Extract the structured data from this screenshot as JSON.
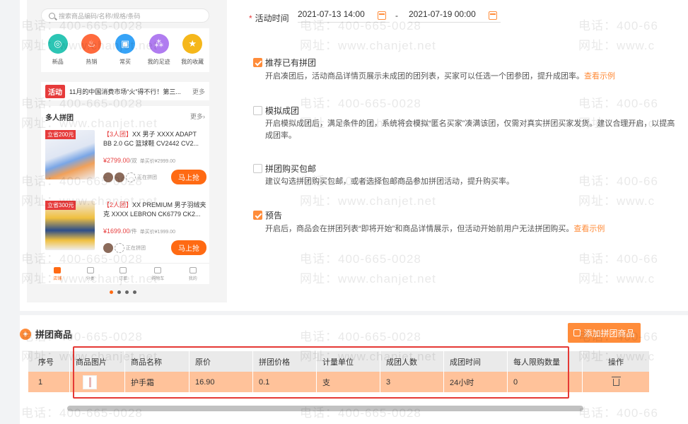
{
  "preview": {
    "search_placeholder": "搜索商品编码/名称/规格/条码",
    "nav": [
      {
        "label": "新品",
        "color": "#2cc5b4",
        "icon": "new-icon"
      },
      {
        "label": "热销",
        "color": "#ff6a3d",
        "icon": "fire-icon"
      },
      {
        "label": "常买",
        "color": "#36a3f7",
        "icon": "bag-icon"
      },
      {
        "label": "我的足迹",
        "color": "#b07cf0",
        "icon": "footprint-icon"
      },
      {
        "label": "我的收藏",
        "color": "#f5b71b",
        "icon": "star-icon"
      }
    ],
    "activity_tag": "活动",
    "activity_text": "11月的中国消费市场“火”得不行！第三...",
    "activity_more": "更多",
    "group_title": "多人拼团",
    "group_more": "更多›",
    "products": [
      {
        "save": "立省200元",
        "team": "【3人团】",
        "name": "XX 男子 XXXX ADAPT BB 2.0 GC 篮球鞋 CV2442 CV2...",
        "price": "¥2799.00",
        "unit": "/双",
        "orig": "单买价¥2999.00",
        "status": "正在拼团",
        "buy": "马上抢"
      },
      {
        "save": "立省300元",
        "team": "【2人团】",
        "name": "XX PREMIUM 男子羽绒夹克 XXXX LEBRON CK6779 CK2...",
        "price": "¥1699.00",
        "unit": "/件",
        "orig": "单买价¥1999.00",
        "status": "正在拼团",
        "buy": "马上抢"
      }
    ],
    "tabs": [
      "店铺",
      "分类",
      "订单",
      "购物车",
      "我的"
    ]
  },
  "settings": {
    "time_label": "活动时间",
    "start": "2021-07-13 14:00",
    "sep": "-",
    "end": "2021-07-19 00:00",
    "options": [
      {
        "title": "推荐已有拼团",
        "checked": true,
        "desc": "开启凑团后，活动商品详情页展示未成团的团列表，买家可以任选一个团参团，提升成团率。",
        "link": "查看示例"
      },
      {
        "title": "模拟成团",
        "checked": false,
        "desc": "开启模拟成团后，满足条件的团，系统将会模拟“匿名买家”凑满该团，仅需对真实拼团买家发货。建议合理开启，以提高成团率。",
        "link": ""
      },
      {
        "title": "拼团购买包邮",
        "checked": false,
        "desc": "建议勾选拼团购买包邮，或者选择包邮商品参加拼团活动，提升购买率。",
        "link": ""
      },
      {
        "title": "预告",
        "checked": true,
        "desc": "开启后，商品会在拼团列表“即将开始”和商品详情展示，但活动开始前用户无法拼团购买。",
        "link": "查看示例"
      }
    ]
  },
  "section": {
    "title": "拼团商品",
    "add_button": "添加拼团商品"
  },
  "table": {
    "headers": [
      "序号",
      "商品图片",
      "商品名称",
      "原价",
      "拼团价格",
      "计量单位",
      "成团人数",
      "成团时间",
      "每人限购数量",
      "操作"
    ],
    "rows": [
      {
        "index": "1",
        "name": "护手霜",
        "price": "16.90",
        "group_price": "0.1",
        "unit": "支",
        "people": "3",
        "time": "24小时",
        "limit": "0"
      }
    ]
  },
  "watermark": {
    "phone": "电话：400-665-0028",
    "site": "网址：www.chanjet.net",
    "phone_cut": "电话：400-66",
    "site_cut": "网址：www.c"
  },
  "colors": {
    "accent": "#ff8c3a",
    "highlight": "#e53935",
    "row": "#ffc29a"
  }
}
